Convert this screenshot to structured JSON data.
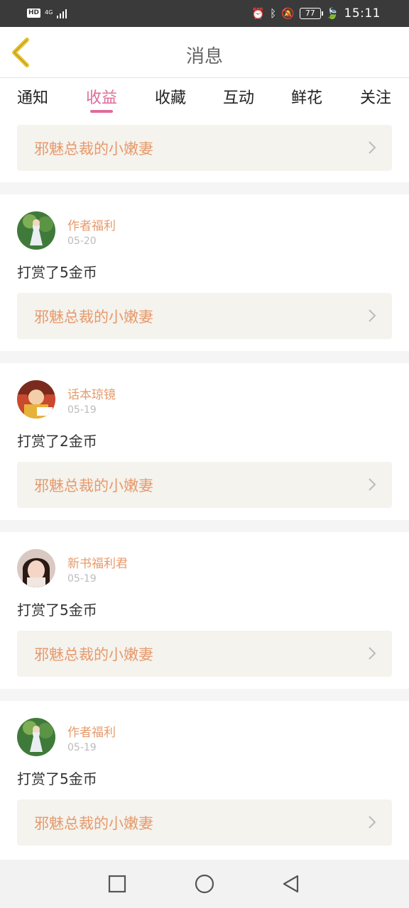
{
  "status_bar": {
    "hd": "HD",
    "network": "4G",
    "battery": "77",
    "time": "15:11"
  },
  "header": {
    "title": "消息"
  },
  "tabs": [
    {
      "label": "通知"
    },
    {
      "label": "收益"
    },
    {
      "label": "收藏"
    },
    {
      "label": "互动"
    },
    {
      "label": "鲜花"
    },
    {
      "label": "关注"
    }
  ],
  "active_tab": "收益",
  "first_card": {
    "book_title": "邪魅总裁的小嫩妻"
  },
  "messages": [
    {
      "author": "作者福利",
      "date": "05-20",
      "text": "打赏了5金币",
      "book_title": "邪魅总裁的小嫩妻"
    },
    {
      "author": "话本琼镜",
      "date": "05-19",
      "text": "打赏了2金币",
      "book_title": "邪魅总裁的小嫩妻"
    },
    {
      "author": "新书福利君",
      "date": "05-19",
      "text": "打赏了5金币",
      "book_title": "邪魅总裁的小嫩妻"
    },
    {
      "author": "作者福利",
      "date": "05-19",
      "text": "打赏了5金币",
      "book_title": "邪魅总裁的小嫩妻"
    }
  ],
  "colors": {
    "accent": "#e06b99",
    "author": "#e79a6c",
    "back_icon": "#e8c22f"
  }
}
